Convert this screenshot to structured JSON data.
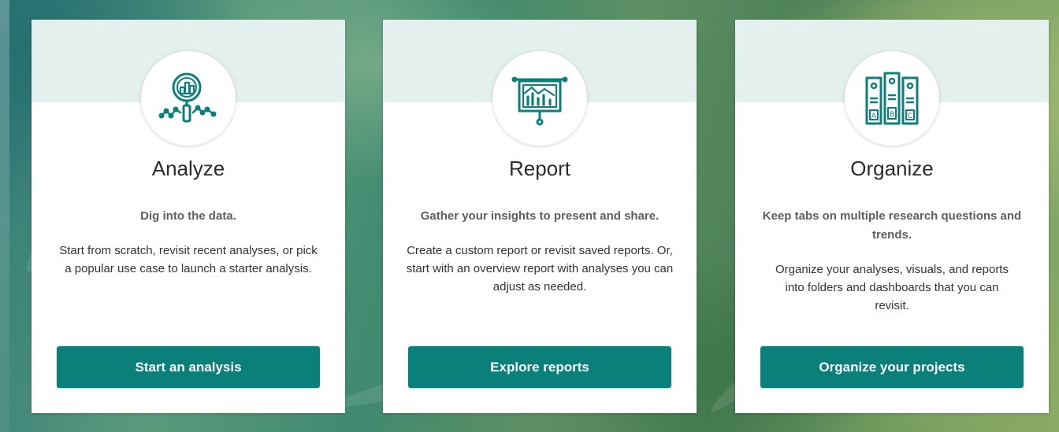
{
  "cards": [
    {
      "icon": "magnifier-chart-icon",
      "title": "Analyze",
      "subtitle": "Dig into the data.",
      "description": "Start from scratch, revisit recent analyses, or pick a popular use case to launch a starter analysis.",
      "button_label": "Start an analysis"
    },
    {
      "icon": "presentation-board-icon",
      "title": "Report",
      "subtitle": "Gather your insights to present and share.",
      "description": "Create a custom report or revisit saved reports. Or, start with an overview report with analyses you can adjust as needed.",
      "button_label": "Explore reports"
    },
    {
      "icon": "binders-icon",
      "title": "Organize",
      "subtitle": "Keep tabs on multiple research questions and trends.",
      "description": "Organize your analyses, visuals, and reports into folders and dashboards that you can revisit.",
      "button_label": "Organize your projects",
      "binder_letters": [
        "A",
        "B",
        "C"
      ]
    }
  ],
  "colors": {
    "accent": "#0b7f79",
    "band": "#e3f0ee",
    "card": "#ffffff"
  }
}
